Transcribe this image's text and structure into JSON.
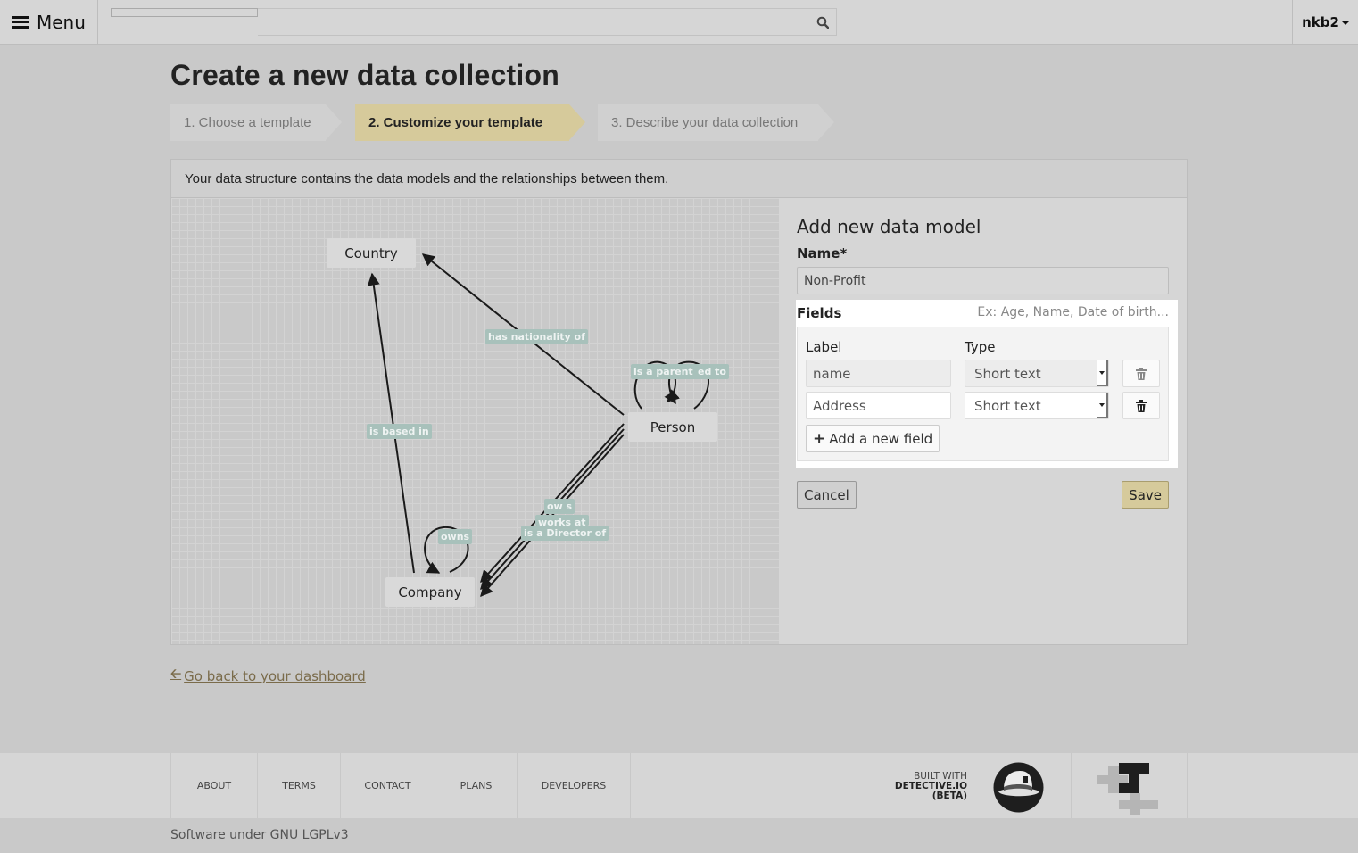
{
  "topbar": {
    "menu_label": "Menu",
    "menu_icon": "hamburger-icon",
    "search_placeholder": "",
    "search_icon": "search-icon",
    "user_label": "nkb2",
    "user_icon": "caret-down-icon"
  },
  "page": {
    "title": "Create a new data collection"
  },
  "steps": [
    {
      "label": "1. Choose a template",
      "active": false
    },
    {
      "label": "2. Customize your template",
      "active": true
    },
    {
      "label": "3. Describe your data collection",
      "active": false
    }
  ],
  "panel": {
    "intro": "Your data structure contains the data models and the relationships between them."
  },
  "graph": {
    "nodes": [
      {
        "id": "country",
        "label": "Country"
      },
      {
        "id": "person",
        "label": "Person"
      },
      {
        "id": "company",
        "label": "Company"
      }
    ],
    "edges": [
      {
        "from": "person",
        "to": "country",
        "label": "has nationality of"
      },
      {
        "from": "company",
        "to": "country",
        "label": "is based in"
      },
      {
        "from": "person",
        "to": "person",
        "label": "is a parent of"
      },
      {
        "from": "person",
        "to": "person",
        "label": "is related to"
      },
      {
        "from": "company",
        "to": "company",
        "label": "owns"
      },
      {
        "from": "person",
        "to": "company",
        "label": "owns"
      },
      {
        "from": "person",
        "to": "company",
        "label": "works at"
      },
      {
        "from": "person",
        "to": "company",
        "label": "is a Director of"
      }
    ],
    "edge_label_visible_text": {
      "parent": "is a parent of",
      "related": "ed to",
      "owns_person": "ow s",
      "works": "works at",
      "director": "is a Director of"
    }
  },
  "form": {
    "title": "Add new data model",
    "name_label": "Name*",
    "name_value": "Non-Profit",
    "fields_title": "Fields",
    "fields_hint": "Ex: Age, Name, Date of birth...",
    "label_header": "Label",
    "type_header": "Type",
    "rows": [
      {
        "label": "name",
        "type": "Short text",
        "editable": false,
        "delete_icon": "trash-icon"
      },
      {
        "label": "Address",
        "type": "Short text",
        "editable": true,
        "delete_icon": "trash-icon"
      }
    ],
    "add_field_label": "Add a new field",
    "add_field_icon": "plus-icon",
    "cancel_label": "Cancel",
    "save_label": "Save"
  },
  "back_link": {
    "label": "Go back to your dashboard",
    "icon": "arrow-left-icon"
  },
  "footer": {
    "links": [
      "About",
      "Terms",
      "Contact",
      "Plans",
      "Developers"
    ],
    "built_with_line1": "BUILT WITH",
    "built_with_line2": "DETECTIVE.IO",
    "built_with_line3": "(BETA)",
    "license": "Software under GNU LGPLv3"
  },
  "colors": {
    "accent": "#d6ca9b",
    "background": "#c9c9c9",
    "edge_label_bg": "#a8c1bb",
    "link": "#7a6b4a"
  }
}
